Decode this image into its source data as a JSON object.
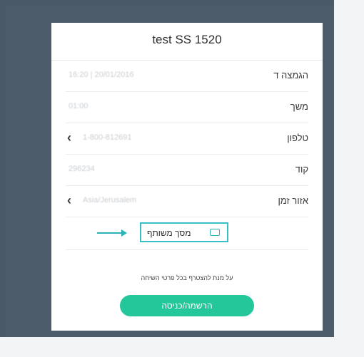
{
  "dialog": {
    "title": "test SS 1520"
  },
  "fields": [
    {
      "label": "הגמצה ד",
      "value": "16:20 | 20/01/2016"
    },
    {
      "label": "משך",
      "value": "01:00"
    },
    {
      "label": "טלפון",
      "value": "1-800-812691"
    },
    {
      "label": "קוד",
      "value": "296234"
    },
    {
      "label": "אזור זמן",
      "value": "Asia/Jerusalem"
    }
  ],
  "share": {
    "label": "מסך משותף"
  },
  "notice": "על מנת להצטרף בכל פרטי השיחה",
  "submit_label": "הרשמה/כניסה",
  "colors": {
    "accent_teal": "#38bfc6",
    "submit_green": "#24c79a",
    "background": "#4a5968"
  }
}
